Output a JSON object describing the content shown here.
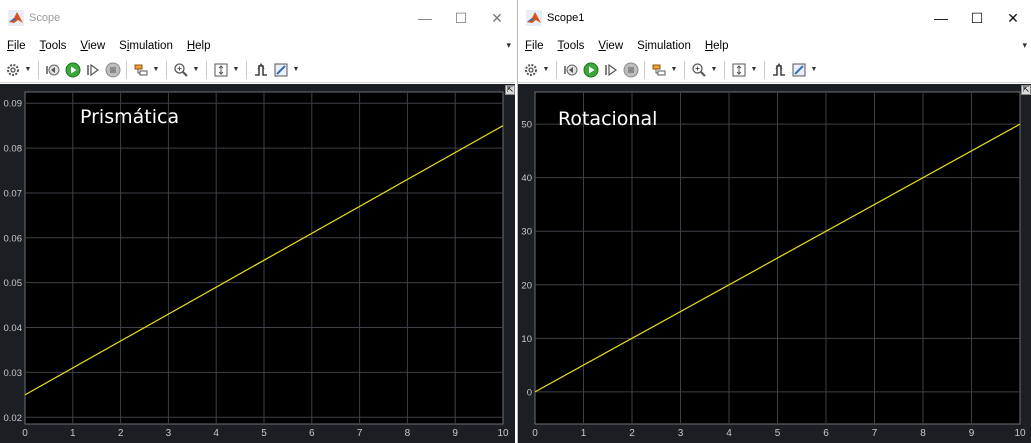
{
  "colors": {
    "plot_bg": "#000000",
    "frame_bg": "#1b1e23",
    "grid": "#3e4147",
    "axis_text": "#c8c8c8",
    "trace": "#e8e01a"
  },
  "windows": [
    {
      "title": "Scope",
      "menu": [
        {
          "key": "F",
          "rest": "ile"
        },
        {
          "key": "T",
          "rest": "ools"
        },
        {
          "key": "V",
          "rest": "iew"
        },
        {
          "key": "Si",
          "rest": "mulation",
          "underline_index": 1
        },
        {
          "key": "H",
          "rest": "elp"
        }
      ],
      "controls": {
        "minimize": "—",
        "maximize": "☐",
        "close": "✕"
      },
      "plot_label": "Prismática"
    },
    {
      "title": "Scope1",
      "menu": [
        {
          "key": "F",
          "rest": "ile"
        },
        {
          "key": "T",
          "rest": "ools"
        },
        {
          "key": "V",
          "rest": "iew"
        },
        {
          "key": "Si",
          "rest": "mulation",
          "underline_index": 1
        },
        {
          "key": "H",
          "rest": "elp"
        }
      ],
      "controls": {
        "minimize": "—",
        "maximize": "☐",
        "close": "✕"
      },
      "plot_label": "Rotacional"
    }
  ],
  "toolbar_icons": [
    "settings-icon",
    "step-back-icon",
    "run-icon",
    "step-forward-icon",
    "stop-icon",
    "highlight-icon",
    "zoom-icon",
    "fit-axes-icon",
    "triggers-icon",
    "cursor-measure-icon"
  ],
  "chart_data": [
    {
      "type": "line",
      "title": "Prismática",
      "xlim": [
        0,
        10
      ],
      "ylim": [
        0.0185,
        0.0925
      ],
      "x_ticks": [
        0,
        1,
        2,
        3,
        4,
        5,
        6,
        7,
        8,
        9,
        10
      ],
      "y_ticks": [
        0.02,
        0.03,
        0.04,
        0.05,
        0.06,
        0.07,
        0.08,
        0.09
      ],
      "y_tick_labels": [
        "0.02",
        "0.03",
        "0.04",
        "0.05",
        "0.06",
        "0.07",
        "0.08",
        "0.09"
      ],
      "grid": true,
      "series": [
        {
          "x": [
            0,
            10
          ],
          "y": [
            0.025,
            0.085
          ]
        }
      ]
    },
    {
      "type": "line",
      "title": "Rotacional",
      "xlim": [
        0,
        10
      ],
      "ylim": [
        -6,
        56
      ],
      "x_ticks": [
        0,
        1,
        2,
        3,
        4,
        5,
        6,
        7,
        8,
        9,
        10
      ],
      "y_ticks": [
        0,
        10,
        20,
        30,
        40,
        50
      ],
      "y_tick_labels": [
        "0",
        "10",
        "20",
        "30",
        "40",
        "50"
      ],
      "grid": true,
      "series": [
        {
          "x": [
            0,
            10
          ],
          "y": [
            0,
            50
          ]
        }
      ]
    }
  ]
}
